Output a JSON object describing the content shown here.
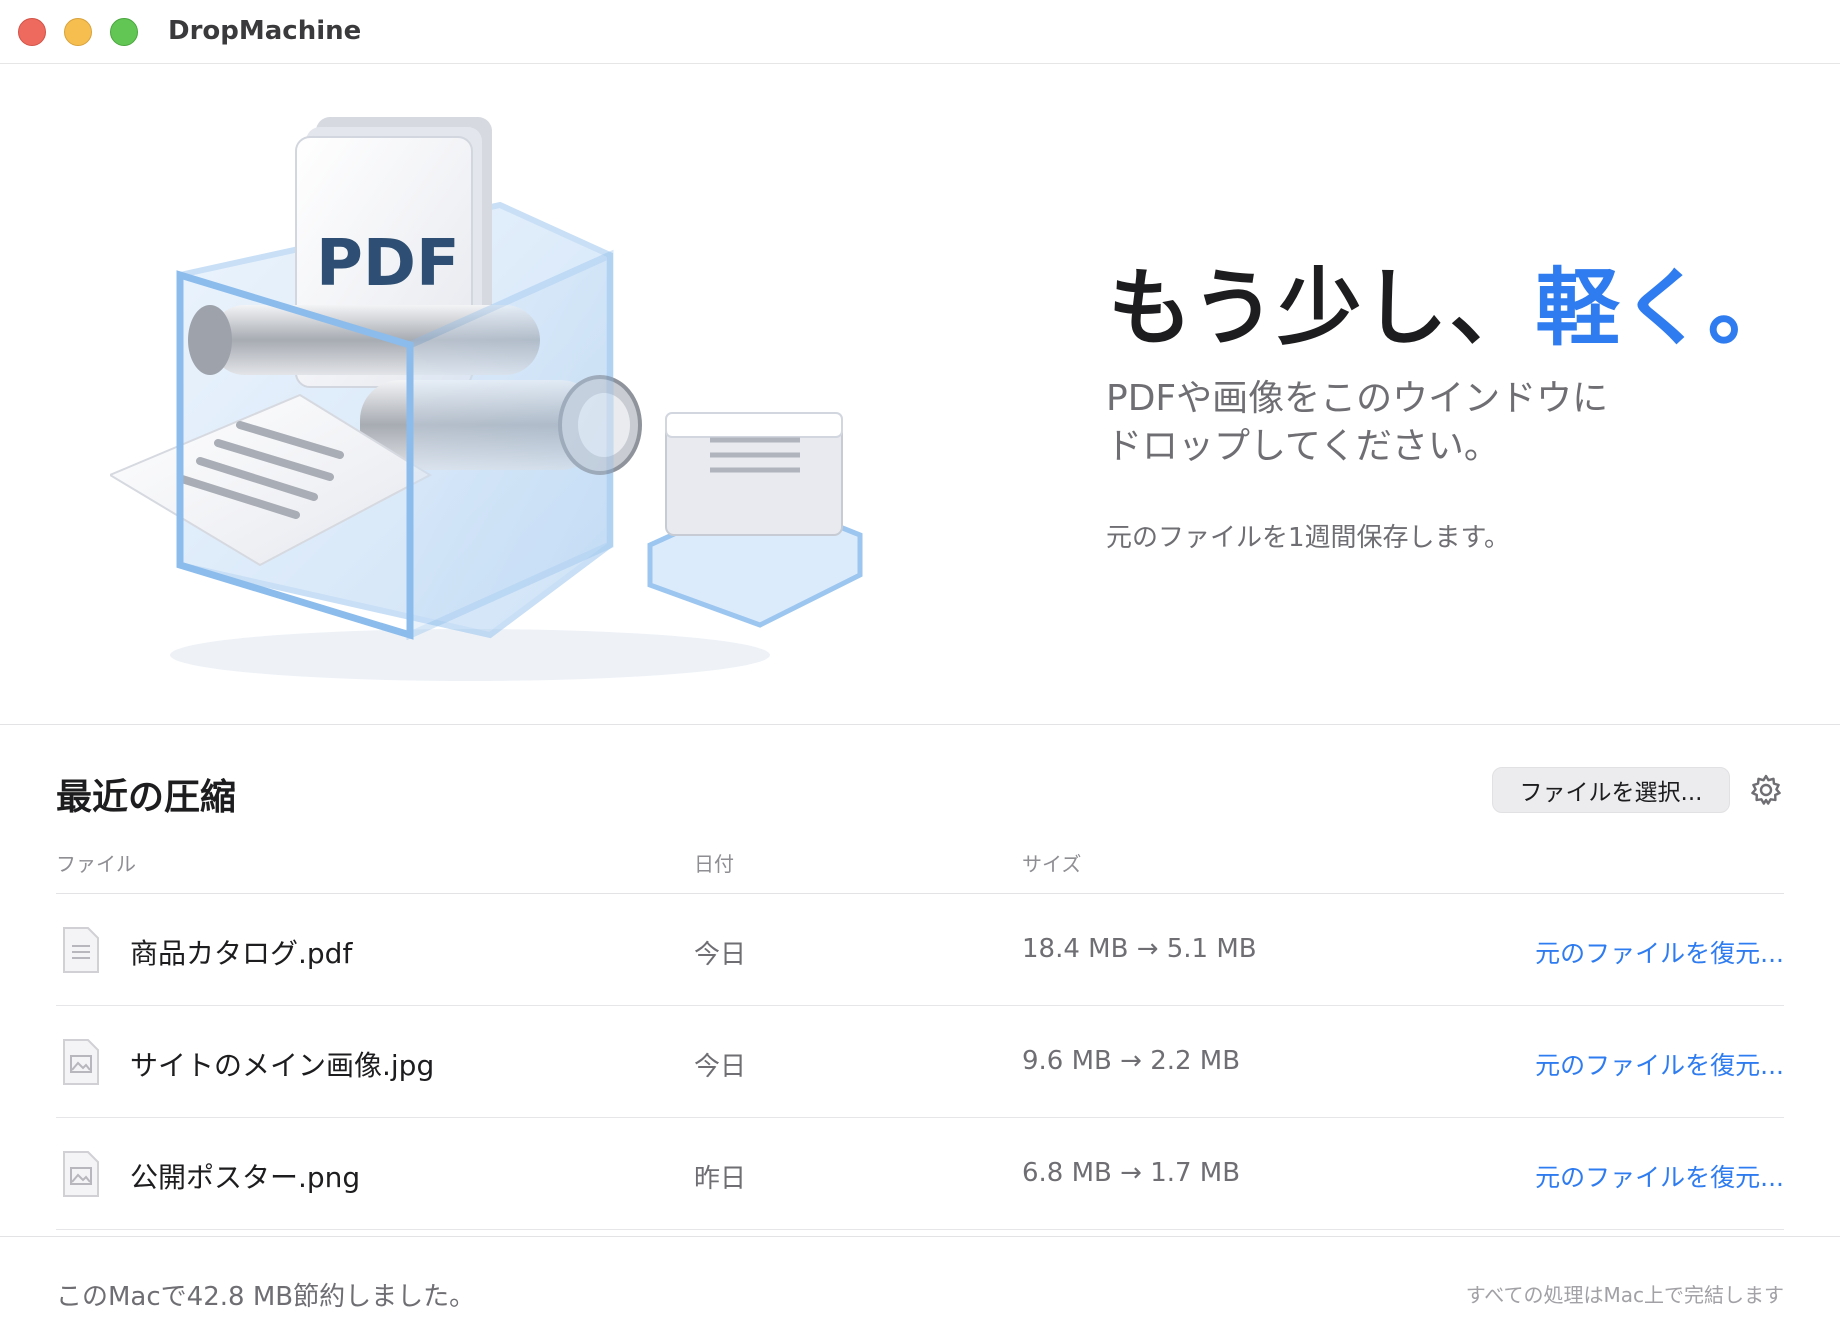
{
  "window": {
    "title": "DropMachine"
  },
  "hero": {
    "illustration_label": "PDF",
    "headline_main": "もう少し、",
    "headline_accent": "軽く。",
    "sub_line1": "PDFや画像をこのウインドウに",
    "sub_line2": "ドロップしてください。",
    "note": "元のファイルを1週間保存します。"
  },
  "recent": {
    "title": "最近の圧縮",
    "select_button": "ファイルを選択...",
    "columns": {
      "file": "ファイル",
      "date": "日付",
      "size": "サイズ"
    },
    "rows": [
      {
        "name": "商品カタログ.pdf",
        "icon": "pdf-file-icon",
        "date": "今日",
        "size": "18.4 MB → 5.1 MB",
        "action": "元のファイルを復元..."
      },
      {
        "name": "サイトのメイン画像.jpg",
        "icon": "image-file-icon",
        "date": "今日",
        "size": "9.6 MB → 2.2 MB",
        "action": "元のファイルを復元..."
      },
      {
        "name": "公開ポスター.png",
        "icon": "image-file-icon",
        "date": "昨日",
        "size": "6.8 MB → 1.7 MB",
        "action": "元のファイルを復元..."
      }
    ]
  },
  "footer": {
    "saved": "このMacで42.8 MB節約しました。",
    "local_note": "すべての処理はMac上で完結します"
  },
  "colors": {
    "accent": "#2f7cf0",
    "text": "#1d1d1f",
    "secondary": "#6e6e73"
  }
}
